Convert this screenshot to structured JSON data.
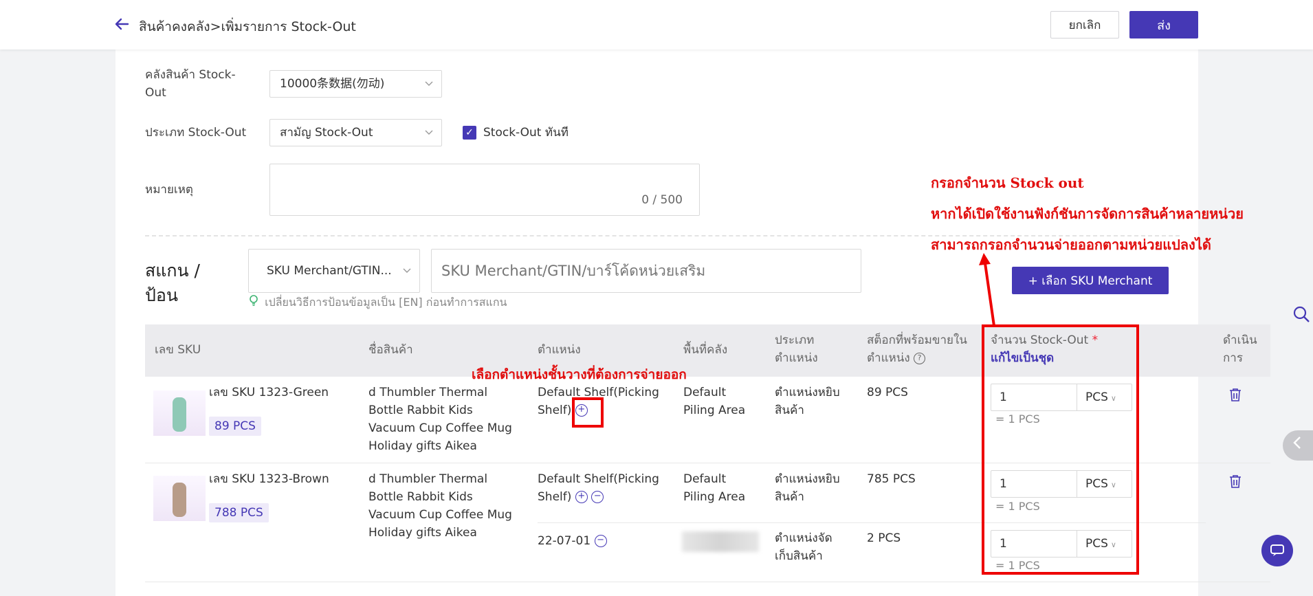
{
  "header": {
    "breadcrumb": "สินค้าคงคลัง>เพิ่มรายการ Stock-Out",
    "cancel_label": "ยกเลิก",
    "submit_label": "ส่ง"
  },
  "form": {
    "warehouse_label_line1": "คลังสินค้า Stock-",
    "warehouse_label_line2": "Out",
    "warehouse_value": "10000条数据(勿动)",
    "type_label": "ประเภท Stock-Out",
    "type_value": "สามัญ Stock-Out",
    "immediate_label": "Stock-Out ทันที",
    "immediate_checked": true,
    "note_label": "หมายเหตุ",
    "note_count": "0 / 500"
  },
  "scan": {
    "title_line1": "สแกน /",
    "title_line2": "ป้อน",
    "mode_value": "SKU Merchant/GTIN...",
    "input_placeholder": "SKU Merchant/GTIN/บาร์โค้ดหน่วยเสริม",
    "hint": "เปลี่ยนวิธีการป้อนข้อมูลเป็น [EN] ก่อนทำการสแกน",
    "pick_button": "+ เลือก SKU Merchant"
  },
  "table": {
    "headers": {
      "sku": "เลข SKU",
      "name": "ชื่อสินค้า",
      "location": "ตำแหน่ง",
      "area": "พื้นที่คลัง",
      "loc_type_line1": "ประเภท",
      "loc_type_line2": "ตำแหน่ง",
      "avail_line1": "สต็อกที่พร้อมขายใน",
      "avail_line2": "ตำแหน่ง",
      "qty_line1": "จำนวน Stock-Out",
      "qty_required": "*",
      "qty_batch": "แก้ไขเป็นชุด",
      "action_line1": "ดำเนิน",
      "action_line2": "การ"
    },
    "rows": [
      {
        "sku": "เลข SKU 1323-Green",
        "stock_badge": "89 PCS",
        "name_lines": [
          "d Thumbler Thermal",
          "Bottle Rabbit Kids",
          "Vacuum Cup Coffee Mug",
          "Holiday gifts Aikea"
        ],
        "locations": [
          {
            "line1": "Default Shelf(Picking",
            "line2": "Shelf)",
            "area_line1": "Default",
            "area_line2": "Piling Area",
            "type_line1": "ตำแหน่งหยิบ",
            "type_line2": "สินค้า",
            "available": "89 PCS",
            "qty": "1",
            "unit": "PCS",
            "equiv": "= 1 PCS"
          }
        ]
      },
      {
        "sku": "เลข SKU 1323-Brown",
        "stock_badge": "788 PCS",
        "name_lines": [
          "d Thumbler Thermal",
          "Bottle Rabbit Kids",
          "Vacuum Cup Coffee Mug",
          "Holiday gifts Aikea"
        ],
        "locations": [
          {
            "line1": "Default Shelf(Picking",
            "line2": "Shelf)",
            "area_line1": "Default",
            "area_line2": "Piling Area",
            "type_line1": "ตำแหน่งหยิบ",
            "type_line2": "สินค้า",
            "available": "785 PCS",
            "qty": "1",
            "unit": "PCS",
            "equiv": "= 1 PCS"
          },
          {
            "line1": "22-07-01",
            "line2": "",
            "area_line1": "",
            "area_line2": "",
            "type_line1": "ตำแหน่งจัด",
            "type_line2": "เก็บสินค้า",
            "available": "2 PCS",
            "qty": "1",
            "unit": "PCS",
            "equiv": "= 1 PCS"
          }
        ]
      }
    ]
  },
  "annotations": {
    "qty_note_line1": "กรอกจำนวน Stock out",
    "qty_note_line2": "หากได้เปิดใช้งานฟังก์ชันการจัดการสินค้าหลายหน่วย",
    "qty_note_line3": "สามารถกรอกจำนวนจ่ายออกตามหน่วยแปลงได้",
    "shelf_note": "เลือกตำแหน่งชั้นวางที่ต้องการจ่ายออก",
    "color": "#e10e0e"
  },
  "colors": {
    "primary": "#4538b5",
    "badge_bg": "#eeeaf9",
    "header_bg": "#ebebee"
  }
}
